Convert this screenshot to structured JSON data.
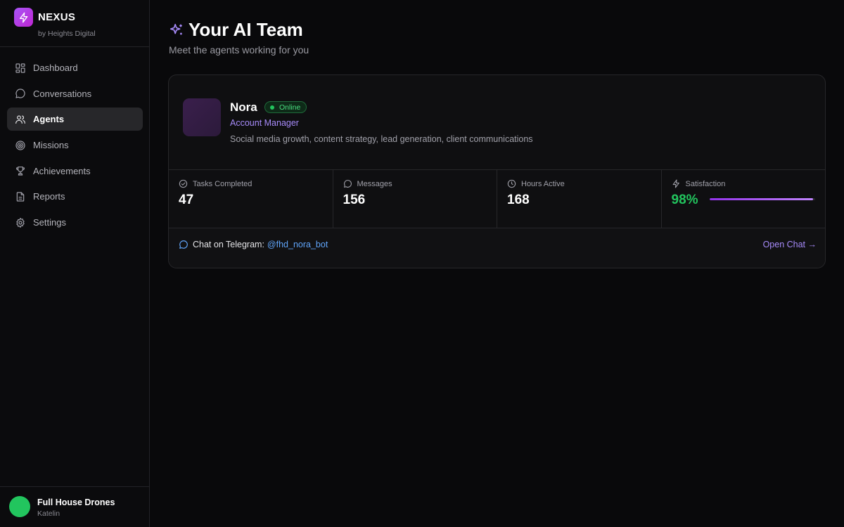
{
  "brand": {
    "name": "NEXUS",
    "subtitle": "by Heights Digital",
    "logo_icon": "lightning-icon"
  },
  "sidebar": {
    "items": [
      {
        "label": "Dashboard",
        "icon": "dashboard-icon",
        "active": false
      },
      {
        "label": "Conversations",
        "icon": "chat-bubble-icon",
        "active": false
      },
      {
        "label": "Agents",
        "icon": "users-icon",
        "active": true
      },
      {
        "label": "Missions",
        "icon": "target-icon",
        "active": false
      },
      {
        "label": "Achievements",
        "icon": "trophy-icon",
        "active": false
      },
      {
        "label": "Reports",
        "icon": "document-icon",
        "active": false
      },
      {
        "label": "Settings",
        "icon": "gear-icon",
        "active": false
      }
    ]
  },
  "user": {
    "name": "Full House Drones",
    "subtitle": "Katelin",
    "avatar_color": "#22c55e"
  },
  "header": {
    "title": "Your AI Team",
    "subtitle": "Meet the agents working for you",
    "icon": "sparkles-icon"
  },
  "agent": {
    "name": "Nora",
    "status": "Online",
    "role": "Account Manager",
    "description": "Social media growth, content strategy, lead generation, client communications",
    "stats": [
      {
        "label": "Tasks Completed",
        "value": "47",
        "icon": "check-circle-icon"
      },
      {
        "label": "Messages",
        "value": "156",
        "icon": "chat-bubble-icon"
      },
      {
        "label": "Hours Active",
        "value": "168",
        "icon": "clock-icon"
      },
      {
        "label": "Satisfaction",
        "value": "98%",
        "icon": "lightning-icon",
        "level": 0.98
      }
    ],
    "chat": {
      "text": "Chat on Telegram:",
      "handle": "@fhd_nora_bot",
      "action": "Open Chat →"
    }
  },
  "colors": {
    "accent": "#a78bfa",
    "success": "#22c55e",
    "link": "#60a5fa",
    "background": "#09090b"
  }
}
